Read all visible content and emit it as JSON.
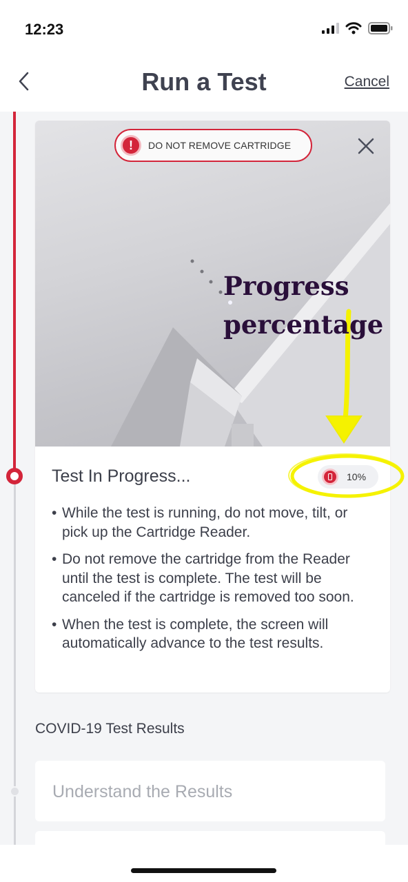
{
  "status_bar": {
    "time": "12:23"
  },
  "header": {
    "title": "Run a Test",
    "cancel_label": "Cancel"
  },
  "banner": {
    "warning_label": "DO NOT REMOVE CARTRIDGE"
  },
  "step": {
    "title": "Test In Progress...",
    "progress_label": "10%",
    "progress_value": 10,
    "bullets": [
      "While the test is running, do not move, tilt, or pick up the Cartridge Reader.",
      "Do not remove the cartridge from the Reader until the test is complete. The test will be canceled if the cartridge is removed too soon.",
      "When the test is complete, the screen will automatically advance to the test results."
    ]
  },
  "section": {
    "heading": "COVID-19 Test Results"
  },
  "future_steps": [
    {
      "label": "Understand the Results"
    }
  ],
  "annotation": {
    "line1": "Progress",
    "line2": "percentage"
  },
  "colors": {
    "accent_red": "#d3253a",
    "highlight_yellow": "#f5f200",
    "annotation_purple": "#2a0f3a"
  },
  "icons": [
    "back-chevron-icon",
    "close-icon",
    "alert-icon",
    "cartridge-reader-icon",
    "wifi-icon",
    "battery-icon",
    "signal-icon"
  ]
}
